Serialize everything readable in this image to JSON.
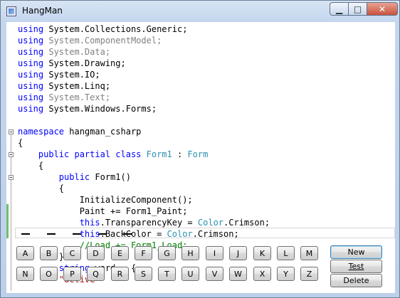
{
  "window": {
    "title": "HangMan"
  },
  "editor": {
    "lines": [
      [
        [
          "kw",
          "using"
        ],
        [
          "tx",
          " System.Collections.Generic;"
        ]
      ],
      [
        [
          "kw",
          "using"
        ],
        [
          "gr",
          " System.ComponentModel;"
        ]
      ],
      [
        [
          "kw",
          "using"
        ],
        [
          "gr",
          " System.Data;"
        ]
      ],
      [
        [
          "kw",
          "using"
        ],
        [
          "tx",
          " System.Drawing;"
        ]
      ],
      [
        [
          "kw",
          "using"
        ],
        [
          "tx",
          " System.IO;"
        ]
      ],
      [
        [
          "kw",
          "using"
        ],
        [
          "tx",
          " System.Linq;"
        ]
      ],
      [
        [
          "kw",
          "using"
        ],
        [
          "gr",
          " System.Text;"
        ]
      ],
      [
        [
          "kw",
          "using"
        ],
        [
          "tx",
          " System.Windows.Forms;"
        ]
      ],
      [],
      [
        [
          "kw",
          "namespace"
        ],
        [
          "tx",
          " hangman_csharp"
        ]
      ],
      [
        [
          "tx",
          "{"
        ]
      ],
      [
        [
          "tx",
          "    "
        ],
        [
          "kw",
          "public partial class"
        ],
        [
          "tp",
          " Form1"
        ],
        [
          "tx",
          " : "
        ],
        [
          "tp",
          "Form"
        ]
      ],
      [
        [
          "tx",
          "    {"
        ]
      ],
      [
        [
          "tx",
          "        "
        ],
        [
          "kw",
          "public"
        ],
        [
          "tx",
          " Form1()"
        ]
      ],
      [
        [
          "tx",
          "        {"
        ]
      ],
      [
        [
          "tx",
          "            InitializeComponent();"
        ]
      ],
      [
        [
          "tx",
          "            Paint += Form1_Paint;"
        ]
      ],
      [
        [
          "tx",
          "            "
        ],
        [
          "kw",
          "this"
        ],
        [
          "tx",
          ".TransparencyKey = "
        ],
        [
          "tp",
          "Color"
        ],
        [
          "tx",
          ".Crimson;"
        ]
      ],
      [
        [
          "tx",
          "            "
        ],
        [
          "kw",
          "this"
        ],
        [
          "tx",
          ".BackColor = "
        ],
        [
          "tp",
          "Color"
        ],
        [
          "tx",
          ".Crimson;"
        ]
      ],
      [
        [
          "tx",
          "            "
        ],
        [
          "cm",
          "//Load += Form1_Load;"
        ]
      ],
      [
        [
          "tx",
          "        }"
        ]
      ],
      [
        [
          "tx",
          "        "
        ],
        [
          "kw",
          "string"
        ],
        [
          "tx",
          " word = {"
        ]
      ],
      [
        [
          "tx",
          "        "
        ],
        [
          "st",
          "\"active\""
        ]
      ]
    ]
  },
  "letters_row1": [
    "A",
    "B",
    "C",
    "D",
    "E",
    "F",
    "G",
    "H",
    "I",
    "J",
    "K",
    "L",
    "M"
  ],
  "letters_row2": [
    "N",
    "O",
    "P",
    "Q",
    "R",
    "S",
    "T",
    "U",
    "V",
    "W",
    "X",
    "Y",
    "Z"
  ],
  "actions": {
    "new": {
      "label": "New"
    },
    "test": {
      "label": "Test"
    },
    "delete": {
      "label": "Delete"
    }
  }
}
